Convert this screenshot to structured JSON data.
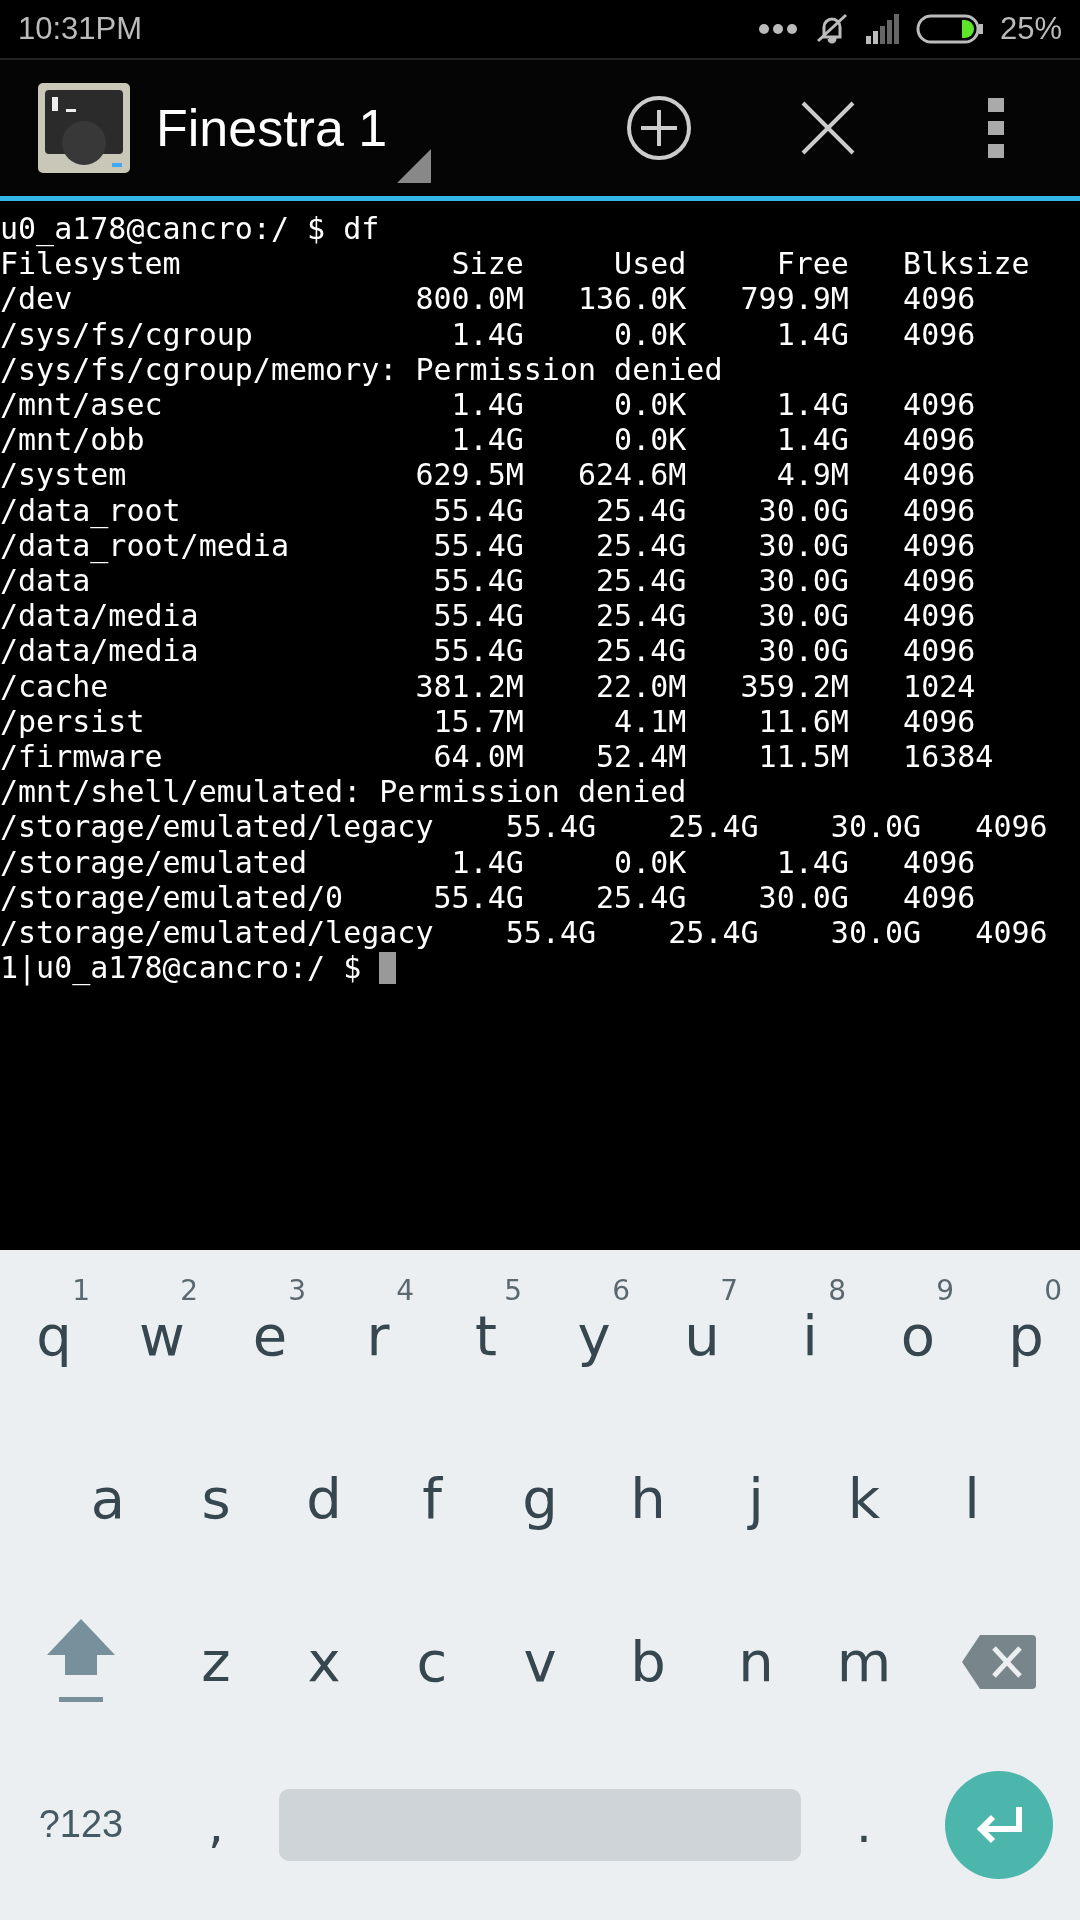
{
  "status_bar": {
    "time": "10:31PM",
    "battery": "25%"
  },
  "toolbar": {
    "title": "Finestra 1"
  },
  "terminal": {
    "lines": [
      {
        "kind": "text",
        "text": "u0_a178@cancro:/ $ df"
      },
      {
        "kind": "row",
        "cells": [
          "Filesystem",
          "Size",
          "Used",
          "Free",
          "Blksize"
        ]
      },
      {
        "kind": "row",
        "cells": [
          "/dev",
          "800.0M",
          "136.0K",
          "799.9M",
          "4096"
        ]
      },
      {
        "kind": "row",
        "cells": [
          "/sys/fs/cgroup",
          "1.4G",
          "0.0K",
          "1.4G",
          "4096"
        ]
      },
      {
        "kind": "text",
        "text": "/sys/fs/cgroup/memory: Permission denied"
      },
      {
        "kind": "row",
        "cells": [
          "/mnt/asec",
          "1.4G",
          "0.0K",
          "1.4G",
          "4096"
        ]
      },
      {
        "kind": "row",
        "cells": [
          "/mnt/obb",
          "1.4G",
          "0.0K",
          "1.4G",
          "4096"
        ]
      },
      {
        "kind": "row",
        "cells": [
          "/system",
          "629.5M",
          "624.6M",
          "4.9M",
          "4096"
        ]
      },
      {
        "kind": "row",
        "cells": [
          "/data_root",
          "55.4G",
          "25.4G",
          "30.0G",
          "4096"
        ]
      },
      {
        "kind": "row",
        "cells": [
          "/data_root/media",
          "55.4G",
          "25.4G",
          "30.0G",
          "4096"
        ]
      },
      {
        "kind": "row",
        "cells": [
          "/data",
          "55.4G",
          "25.4G",
          "30.0G",
          "4096"
        ]
      },
      {
        "kind": "row",
        "cells": [
          "/data/media",
          "55.4G",
          "25.4G",
          "30.0G",
          "4096"
        ]
      },
      {
        "kind": "row",
        "cells": [
          "/data/media",
          "55.4G",
          "25.4G",
          "30.0G",
          "4096"
        ]
      },
      {
        "kind": "row",
        "cells": [
          "/cache",
          "381.2M",
          "22.0M",
          "359.2M",
          "1024"
        ]
      },
      {
        "kind": "row",
        "cells": [
          "/persist",
          "15.7M",
          "4.1M",
          "11.6M",
          "4096"
        ]
      },
      {
        "kind": "row",
        "cells": [
          "/firmware",
          "64.0M",
          "52.4M",
          "11.5M",
          "16384"
        ]
      },
      {
        "kind": "text",
        "text": "/mnt/shell/emulated: Permission denied"
      },
      {
        "kind": "row",
        "cells": [
          "/storage/emulated/legacy",
          "55.4G",
          "25.4G",
          "30.0G",
          "4096"
        ]
      },
      {
        "kind": "row",
        "cells": [
          "/storage/emulated",
          "1.4G",
          "0.0K",
          "1.4G",
          "4096"
        ]
      },
      {
        "kind": "row",
        "cells": [
          "/storage/emulated/0",
          "55.4G",
          "25.4G",
          "30.0G",
          "4096"
        ]
      },
      {
        "kind": "row",
        "cells": [
          "/storage/emulated/legacy",
          "55.4G",
          "25.4G",
          "30.0G",
          "4096"
        ]
      },
      {
        "kind": "prompt",
        "text": "1|u0_a178@cancro:/ $",
        "cursor": true
      }
    ]
  },
  "keyboard": {
    "rows": [
      {
        "keys": [
          {
            "kind": "letter",
            "label": "q",
            "hint": "1"
          },
          {
            "kind": "letter",
            "label": "w",
            "hint": "2"
          },
          {
            "kind": "letter",
            "label": "e",
            "hint": "3"
          },
          {
            "kind": "letter",
            "label": "r",
            "hint": "4"
          },
          {
            "kind": "letter",
            "label": "t",
            "hint": "5"
          },
          {
            "kind": "letter",
            "label": "y",
            "hint": "6"
          },
          {
            "kind": "letter",
            "label": "u",
            "hint": "7"
          },
          {
            "kind": "letter",
            "label": "i",
            "hint": "8"
          },
          {
            "kind": "letter",
            "label": "o",
            "hint": "9"
          },
          {
            "kind": "letter",
            "label": "p",
            "hint": "0"
          }
        ]
      },
      {
        "keys": [
          {
            "kind": "letter",
            "label": "a"
          },
          {
            "kind": "letter",
            "label": "s"
          },
          {
            "kind": "letter",
            "label": "d"
          },
          {
            "kind": "letter",
            "label": "f"
          },
          {
            "kind": "letter",
            "label": "g"
          },
          {
            "kind": "letter",
            "label": "h"
          },
          {
            "kind": "letter",
            "label": "j"
          },
          {
            "kind": "letter",
            "label": "k"
          },
          {
            "kind": "letter",
            "label": "l"
          }
        ]
      },
      {
        "keys": [
          {
            "kind": "shift"
          },
          {
            "kind": "letter",
            "label": "z"
          },
          {
            "kind": "letter",
            "label": "x"
          },
          {
            "kind": "letter",
            "label": "c"
          },
          {
            "kind": "letter",
            "label": "v"
          },
          {
            "kind": "letter",
            "label": "b"
          },
          {
            "kind": "letter",
            "label": "n"
          },
          {
            "kind": "letter",
            "label": "m"
          },
          {
            "kind": "backspace"
          }
        ]
      },
      {
        "keys": [
          {
            "kind": "symbols",
            "label": "?123"
          },
          {
            "kind": "punct",
            "label": ","
          },
          {
            "kind": "space"
          },
          {
            "kind": "punct",
            "label": "."
          },
          {
            "kind": "enter"
          }
        ]
      }
    ]
  }
}
